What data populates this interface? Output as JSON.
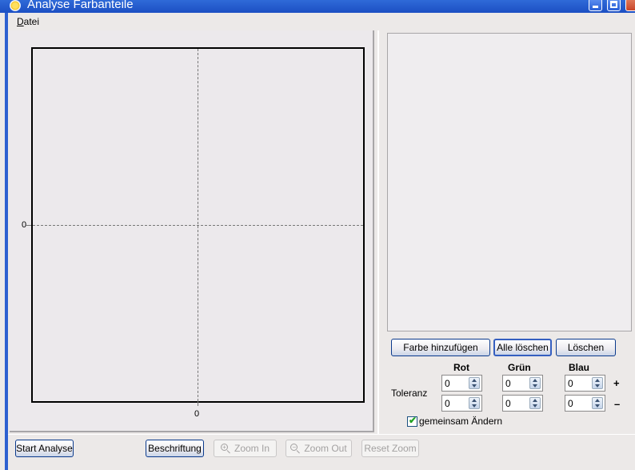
{
  "window": {
    "title": "Analyse Farbanteile",
    "controls": [
      "minimize",
      "maximize",
      "close"
    ]
  },
  "menu": {
    "items": [
      {
        "label": "Datei",
        "accel": "D",
        "rest": "atei"
      }
    ]
  },
  "plot": {
    "y_zero_label": "0",
    "x_zero_label": "0"
  },
  "color_buttons": {
    "add": "Farbe hinzufügen",
    "delete_all": "Alle löschen",
    "delete": "Löschen"
  },
  "tolerance": {
    "label": "Toleranz",
    "columns": [
      "Rot",
      "Grün",
      "Blau"
    ],
    "plus_row": {
      "sign": "+",
      "values": [
        "0",
        "0",
        "0"
      ]
    },
    "minus_row": {
      "sign": "–",
      "values": [
        "0",
        "0",
        "0"
      ]
    },
    "link_checkbox": {
      "label": "gemeinsam Ändern",
      "checked": true
    }
  },
  "bottom_buttons": {
    "start": "Start Analyse",
    "labels": "Beschriftung",
    "zoom_in": "Zoom In",
    "zoom_out": "Zoom Out",
    "reset_zoom": "Reset Zoom"
  }
}
